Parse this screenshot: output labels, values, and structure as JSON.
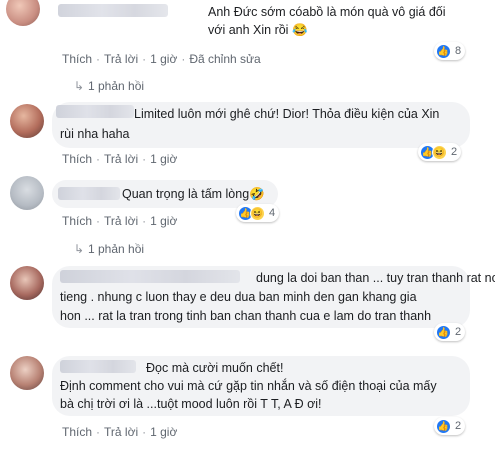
{
  "labels": {
    "like": "Thích",
    "reply": "Trả lời",
    "sep": "·"
  },
  "comments": [
    {
      "lines": [
        "Anh Đức sớm cóabồ là món quà vô giá đối",
        "với anh Xin rồi"
      ],
      "time": "1 giờ",
      "edited": "Đã chỉnh sửa",
      "reaction_count": "8",
      "reactions": [
        "like"
      ],
      "emoji": "😂",
      "replies": "1 phản hồi"
    },
    {
      "lines": [
        "Limited luôn mới ghê chứ! Dior! Thỏa điều kiện của Xin",
        "rùi nha haha"
      ],
      "time": "1 giờ",
      "reaction_count": "2",
      "reactions": [
        "like",
        "haha"
      ]
    },
    {
      "lines": [
        "Quan trọng là tấm lòng"
      ],
      "emoji": "🤣",
      "time": "1 giờ",
      "reaction_count": "4",
      "reactions": [
        "like",
        "haha"
      ],
      "replies": "1 phản hồi"
    },
    {
      "lines": [
        "dung la doi ban than ... tuy tran thanh rat noi",
        "tieng . nhung c luon thay e deu dua ban minh den gan khang gia",
        "hon ... rat la tran trong tinh ban chan thanh cua e lam do tran thanh"
      ],
      "time": "1 giờ",
      "reaction_count": "2",
      "reactions": [
        "like"
      ]
    },
    {
      "lines": [
        "Đọc mà cười muốn chết!",
        "Định comment cho vui mà cứ gặp tin nhắn và số điện thoại của mấy",
        "bà chị trời ơi là ...tuột mood luôn rồi T T, A Đ ơi!"
      ],
      "time": "1 giờ",
      "reaction_count": "2",
      "reactions": [
        "like"
      ]
    }
  ]
}
